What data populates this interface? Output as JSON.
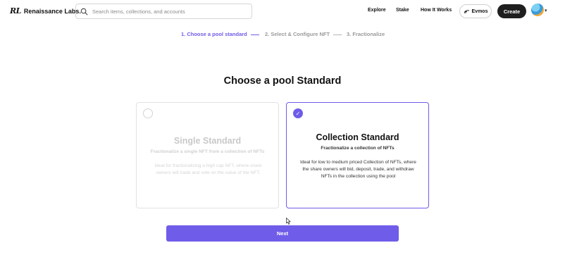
{
  "header": {
    "logo_mark": "RL",
    "logo_text": "Renaissance Labs.",
    "search_placeholder": "Search items, collections, and accounts",
    "nav": [
      "Explore",
      "Stake",
      "How It Works"
    ],
    "network_label": "Evmos",
    "create_label": "Create"
  },
  "stepper": {
    "steps": [
      "1. Choose a pool standard",
      "2. Select & Configure NFT",
      "3. Fractionalize"
    ],
    "active_index": 0
  },
  "page_title": "Choose a pool Standard",
  "cards": [
    {
      "title": "Single Standard",
      "subtitle": "Fractionalize a single NFT from a collection of NFTs",
      "description": "Ideal for fractionalizing a high cap NFT, where share owners will trade and vote on the value of the NFT.",
      "selected": false
    },
    {
      "title": "Collection Standard",
      "subtitle": "Fractionalize a collection of NFTs",
      "description": "Ideal for low to medium priced Collection of NFTs, where the share owners will bid, deposit, trade, and withdraw NFTs in the collection using the pool",
      "selected": true
    }
  ],
  "next_label": "Next",
  "colors": {
    "accent": "#6f5ce8",
    "dark_button": "#1f1f1f",
    "inactive_text": "#c9c9c9"
  }
}
